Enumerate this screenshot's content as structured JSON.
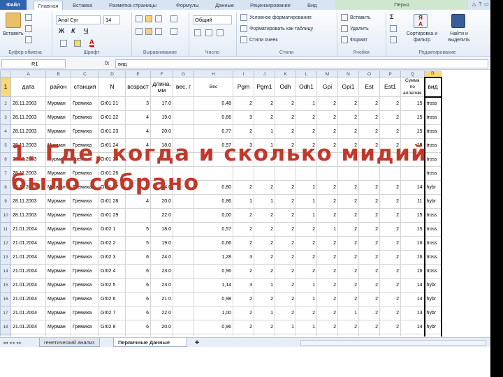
{
  "ribbon": {
    "tabs": [
      "Файл",
      "Главная",
      "Вставка",
      "Разметка страницы",
      "Формулы",
      "Данные",
      "Рецензирование",
      "Вид"
    ],
    "title_tab": "Перья",
    "clipboard": {
      "paste": "Вставить",
      "group": "Буфер обмена"
    },
    "font": {
      "name": "Arial Cyr",
      "size": "14",
      "bold": "Ж",
      "italic": "К",
      "underline": "Ч",
      "group": "Шрифт"
    },
    "alignment": {
      "group": "Выравнивание"
    },
    "number": {
      "format": "Общий",
      "group": "Число"
    },
    "styles": {
      "conditional": "Условное форматирование",
      "as_table": "Форматировать как таблицу",
      "cell_styles": "Стили ячеек",
      "group": "Стили"
    },
    "cells": {
      "insert": "Вставить",
      "delete": "Удалить",
      "format": "Формат",
      "group": "Ячейки"
    },
    "editing": {
      "sort": "Сортировка и фильтр",
      "find": "Найти и выделить",
      "group": "Редактирование"
    }
  },
  "formula_bar": {
    "cell": "R1",
    "fx": "fx",
    "value": "вид"
  },
  "sheet": {
    "columns": [
      "A",
      "B",
      "C",
      "D",
      "E",
      "F",
      "G",
      "H",
      "I",
      "J",
      "K",
      "L",
      "M",
      "N",
      "O",
      "P",
      "Q",
      "R"
    ],
    "selected_column": "R",
    "headers": [
      "дата",
      "район",
      "станция",
      "N",
      "возраст",
      "длина, мм",
      "вес, г",
      "Вес",
      "Pgm",
      "Pgm1",
      "Odh",
      "Odh1",
      "Gpi",
      "Gpi1",
      "Est",
      "Est1",
      "Сумма по аллелям",
      "вид"
    ],
    "rows": [
      {
        "n": "2",
        "cells": [
          "28.11.2003",
          "Мурман",
          "Гремиха",
          "Gr01 21",
          "3",
          "17.0",
          "",
          "0,48",
          "2",
          "2",
          "2",
          "1",
          "2",
          "2",
          "2",
          "2",
          "15",
          "tross"
        ]
      },
      {
        "n": "3",
        "cells": [
          "28.11.2003",
          "Мурман",
          "Гремиха",
          "Gr01 22",
          "4",
          "19.0",
          "",
          "0,66",
          "3",
          "2",
          "2",
          "2",
          "2",
          "2",
          "2",
          "2",
          "15",
          "tross"
        ]
      },
      {
        "n": "4",
        "cells": [
          "28.11.2003",
          "Мурман",
          "Гремиха",
          "Gr01 23",
          "4",
          "20.0",
          "",
          "0,77",
          "2",
          "1",
          "2",
          "2",
          "2",
          "2",
          "2",
          "2",
          "15",
          "tross"
        ]
      },
      {
        "n": "5",
        "cells": [
          "28.11.2003",
          "Мурман",
          "Гремиха",
          "Gr01 24",
          "4",
          "18.0",
          "",
          "0,57",
          "3",
          "1",
          "2",
          "2",
          "2",
          "2",
          "2",
          "2",
          "15",
          "tross"
        ]
      },
      {
        "n": "6",
        "cells": [
          "28.11.2003",
          "Мурман",
          "Гремиха",
          "Gr01 25",
          "",
          "",
          "",
          "",
          "",
          "",
          "",
          "",
          "",
          "",
          "",
          "",
          "",
          "tross"
        ]
      },
      {
        "n": "7",
        "cells": [
          "28.11.2003",
          "Мурман",
          "Гремиха",
          "Gr01 26",
          "",
          "",
          "",
          "",
          "",
          "",
          "",
          "",
          "",
          "",
          "",
          "",
          "",
          "tross"
        ]
      },
      {
        "n": "8",
        "cells": [
          "28.11.2003",
          "Мурман",
          "Гремиха",
          "Gr01 27",
          "5",
          "24.0",
          "",
          "0,80",
          "2",
          "2",
          "2",
          "1",
          "2",
          "2",
          "2",
          "2",
          "14",
          "hybr"
        ]
      },
      {
        "n": "9",
        "cells": [
          "28.11.2003",
          "Мурман",
          "Гремиха",
          "Gr01 28",
          "4",
          "20.0",
          "",
          "0,86",
          "1",
          "1",
          "2",
          "1",
          "2",
          "2",
          "2",
          "2",
          "11",
          "hybr"
        ]
      },
      {
        "n": "10",
        "cells": [
          "28.11.2003",
          "Мурман",
          "Гремиха",
          "Gr01 29",
          "",
          "22.0",
          "",
          "0,00",
          "2",
          "2",
          "2",
          "1",
          "2",
          "2",
          "2",
          "2",
          "15",
          "tross"
        ]
      },
      {
        "n": "11",
        "cells": [
          "21.01.2004",
          "Мурман",
          "Гремиха",
          "Gr02 1",
          "5",
          "18.0",
          "",
          "0,57",
          "2",
          "2",
          "2",
          "2",
          "1",
          "2",
          "2",
          "2",
          "15",
          "tross"
        ]
      },
      {
        "n": "12",
        "cells": [
          "21.01.2004",
          "Мурман",
          "Гремиха",
          "Gr02 2",
          "5",
          "19.0",
          "",
          "0,66",
          "2",
          "2",
          "2",
          "2",
          "2",
          "2",
          "2",
          "2",
          "16",
          "tross"
        ]
      },
      {
        "n": "13",
        "cells": [
          "21.01.2004",
          "Мурман",
          "Гремиха",
          "Gr02 3",
          "6",
          "24.0",
          "",
          "1,28",
          "3",
          "2",
          "2",
          "2",
          "2",
          "2",
          "2",
          "2",
          "16",
          "tross"
        ]
      },
      {
        "n": "14",
        "cells": [
          "21.01.2004",
          "Мурман",
          "Гремиха",
          "Gr02 4",
          "6",
          "23.0",
          "",
          "0,96",
          "2",
          "2",
          "2",
          "2",
          "2",
          "2",
          "2",
          "2",
          "16",
          "tross"
        ]
      },
      {
        "n": "15",
        "cells": [
          "21.01.2004",
          "Мурман",
          "Гремиха",
          "Gr02 5",
          "6",
          "23.0",
          "",
          "1,14",
          "3",
          "1",
          "2",
          "1",
          "2",
          "2",
          "2",
          "2",
          "14",
          "hybr"
        ]
      },
      {
        "n": "16",
        "cells": [
          "21.01.2004",
          "Мурман",
          "Гремиха",
          "Gr02 6",
          "6",
          "21.0",
          "",
          "0,98",
          "2",
          "2",
          "2",
          "1",
          "2",
          "2",
          "2",
          "2",
          "14",
          "hybr"
        ]
      },
      {
        "n": "17",
        "cells": [
          "21.01.2004",
          "Мурман",
          "Гремиха",
          "Gr02 7",
          "6",
          "22.0",
          "",
          "1,00",
          "2",
          "1",
          "2",
          "2",
          "2",
          "1",
          "2",
          "2",
          "13",
          "hybr"
        ]
      },
      {
        "n": "18",
        "cells": [
          "21.01.2004",
          "Мурман",
          "Гремиха",
          "Gr02 8",
          "6",
          "20.0",
          "",
          "0,96",
          "2",
          "2",
          "1",
          "1",
          "2",
          "2",
          "2",
          "2",
          "14",
          "hybr"
        ]
      },
      {
        "n": "19",
        "cells": [
          "23.12.2005",
          "Мурман",
          "Корзовка",
          "K1",
          "3",
          "12.0",
          "",
          "0,18",
          "3",
          "2",
          "2",
          "1",
          "2",
          "2",
          "2",
          "2",
          "14",
          "tross"
        ]
      },
      {
        "n": "20",
        "cells": [
          "23.12.2005",
          "Мурман",
          "Корзовка",
          "K10",
          "4",
          "15.0",
          "",
          "0,24",
          "1",
          "1",
          "1",
          "1",
          "1",
          "1",
          "1",
          "1",
          "8",
          "ed"
        ]
      },
      {
        "n": "21",
        "cells": [
          "23.12.2005",
          "Мурман",
          "Корзовка",
          "K11",
          "4",
          "16.0",
          "",
          "0,41",
          "1",
          "1",
          "1",
          "1",
          "1",
          "1",
          "1",
          "1",
          "8",
          "ed"
        ]
      }
    ]
  },
  "sheet_tabs": [
    "генетический анализ",
    "Первичные Данные"
  ],
  "overlay": {
    "line1": "1. Где, когда и сколько мидий",
    "line2": "было собрано"
  }
}
